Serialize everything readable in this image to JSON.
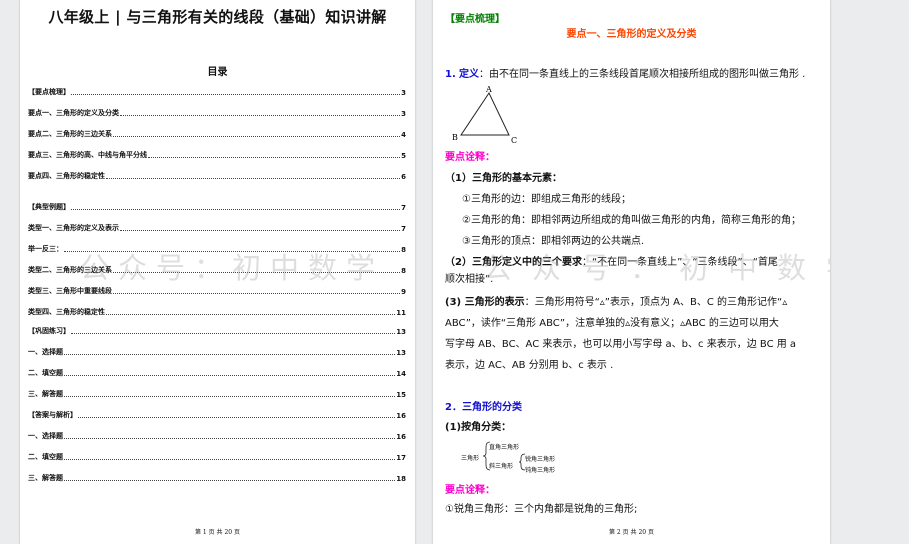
{
  "page1": {
    "title": "八年级上 | 与三角形有关的线段（基础）知识讲解",
    "toc_title": "目录",
    "toc": [
      {
        "text": "【要点梳理】",
        "page": "3"
      },
      {
        "text": "要点一、三角形的定义及分类",
        "page": "3"
      },
      {
        "text": "要点二、三角形的三边关系",
        "page": "4"
      },
      {
        "text": "要点三、三角形的高、中线与角平分线",
        "page": "5"
      },
      {
        "text": "要点四、三角形的稳定性",
        "page": "6"
      },
      {
        "text": "【典型例题】",
        "page": "7"
      },
      {
        "text": "类型一、三角形的定义及表示",
        "page": "7"
      },
      {
        "text": "举一反三：",
        "page": "8"
      },
      {
        "text": "类型二、三角形的三边关系",
        "page": "8"
      },
      {
        "text": "类型三、三角形中重要线段",
        "page": "9"
      },
      {
        "text": "类型四、三角形的稳定性",
        "page": "11"
      },
      {
        "text": "【巩固练习】",
        "page": "13"
      },
      {
        "text": "一、选择题",
        "page": "13"
      },
      {
        "text": "二、填空题",
        "page": "14"
      },
      {
        "text": "三、解答题",
        "page": "15"
      },
      {
        "text": "【答案与解析】",
        "page": "16"
      },
      {
        "text": "一、选择题",
        "page": "16"
      },
      {
        "text": "二、填空题",
        "page": "17"
      },
      {
        "text": "三、解答题",
        "page": "18"
      }
    ],
    "footer": "第 1 页 共 20 页"
  },
  "watermark": "公众号：初中数学",
  "page2": {
    "heading": "【要点梳理】",
    "section_title": "要点一、三角形的定义及分类",
    "def_num": "1.",
    "def_label": "定义",
    "def_text": "：由不在同一条直线上的三条线段首尾顺次相接所组成的图形叫做三角形 .",
    "triangle_labels": {
      "a": "A",
      "b": "B",
      "c": "C"
    },
    "note1": "要点诠释：",
    "elements_title": "（1）三角形的基本元素：",
    "el1": "①三角形的边：即组成三角形的线段；",
    "el2": "②三角形的角：即相邻两边所组成的角叫做三角形的内角，简称三角形的角；",
    "el3": "③三角形的顶点：即相邻两边的公共端点.",
    "req_label": "（2）三角形定义中的三个要求",
    "req_text_1": "：“不在同一条直线上”、“三条线段”、“首尾",
    "req_text_2": "顺次相接”.",
    "rep_label": "(3) 三角形的表示",
    "rep_text_1": "：三角形用符号“▵”表示，顶点为 A、B、C 的三角形记作“▵",
    "rep_text_2": "ABC”，读作“三角形 ABC”，注意单独的▵没有意义；▵ABC 的三边可以用大",
    "rep_text_3": "写字母 AB、BC、AC 来表示，也可以用小写字母 a、b、c 来表示，边 BC 用 a",
    "rep_text_4": "表示，边 AC、AB 分别用 b、c 表示 .",
    "class_title": "2．三角形的分类",
    "by_angle": "(1)按角分类：",
    "cls_root": "三角形",
    "cls_right": "直角三角形",
    "cls_oblique": "斜三角形",
    "cls_acute": "锐角三角形",
    "cls_obtuse": "钝角三角形",
    "note2": "要点诠释：",
    "acute_def": "①锐角三角形：三个内角都是锐角的三角形;",
    "footer": "第 2 页 共 20 页"
  }
}
